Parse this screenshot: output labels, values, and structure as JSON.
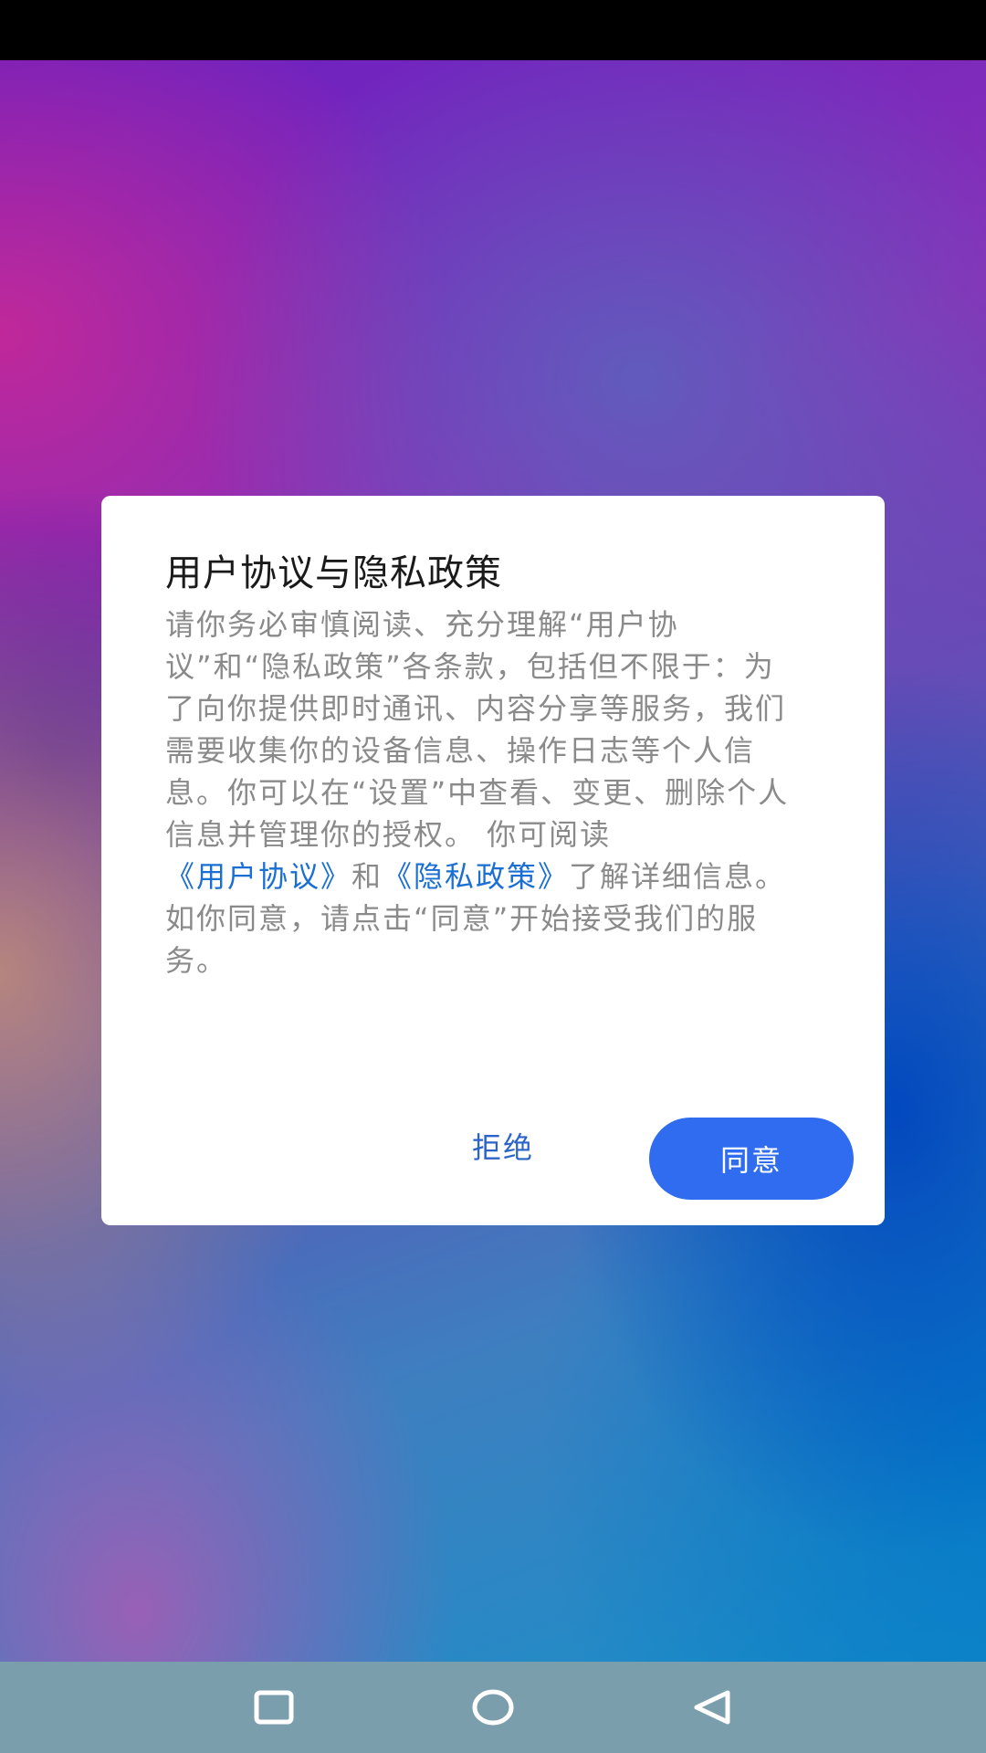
{
  "dialog": {
    "title": "用户协议与隐私政策",
    "body_part1": "请你务必审慎阅读、充分理解“用户协议”和“隐私政策”各条款，包括但不限于：为了向你提供即时通讯、内容分享等服务，我们需要收集你的设备信息、操作日志等个人信息。你可以在“设置”中查看、变更、删除个人信息并管理你的授权。 你可阅读",
    "link_user_agreement": "《用户协议》",
    "body_part2": "和",
    "link_privacy_policy": "《隐私政策》",
    "body_part3": "了解详细信息。如你同意，请点击“同意”开始接受我们的服务。",
    "reject_label": "拒绝",
    "agree_label": "同意"
  },
  "nav_bar": {
    "recent_icon": "square-recent-apps-icon",
    "home_icon": "circle-home-icon",
    "back_icon": "triangle-back-icon"
  },
  "colors": {
    "link": "#1a6fd4",
    "agree_button": "#2f6cf0",
    "reject_text": "#2b63c8",
    "nav_bar": "#7b9eac"
  }
}
